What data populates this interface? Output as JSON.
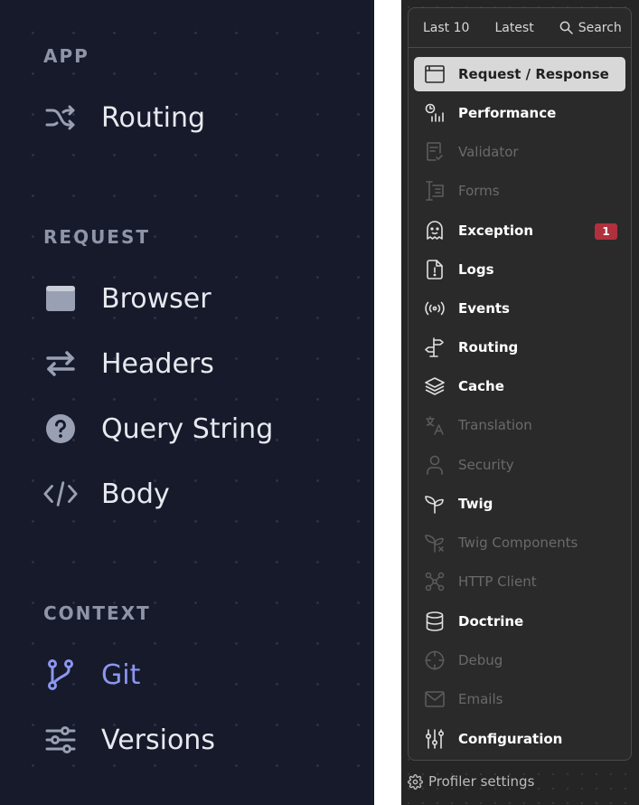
{
  "left_panel": {
    "sections": [
      {
        "title": "APP",
        "items": [
          {
            "label": "Routing",
            "icon": "shuffle-icon"
          }
        ]
      },
      {
        "title": "REQUEST",
        "items": [
          {
            "label": "Browser",
            "icon": "browser-icon"
          },
          {
            "label": "Headers",
            "icon": "arrows-exchange-icon"
          },
          {
            "label": "Query String",
            "icon": "question-circle-icon"
          },
          {
            "label": "Body",
            "icon": "code-icon"
          }
        ]
      },
      {
        "title": "CONTEXT",
        "items": [
          {
            "label": "Git",
            "icon": "git-branch-icon",
            "active": true
          },
          {
            "label": "Versions",
            "icon": "sliders-icon"
          }
        ]
      }
    ],
    "colors": {
      "background": "#161a2b",
      "active": "#8c96f0",
      "text": "#e7e9ef",
      "section": "#8f95a8"
    }
  },
  "profiler_menu": {
    "tabs": {
      "last10": "Last 10",
      "latest": "Latest",
      "search": "Search"
    },
    "items": [
      {
        "label": "Request / Response",
        "icon": "window-icon",
        "selected": true
      },
      {
        "label": "Performance",
        "icon": "timer-bars-icon"
      },
      {
        "label": "Validator",
        "icon": "validator-icon",
        "disabled": true
      },
      {
        "label": "Forms",
        "icon": "form-icon",
        "disabled": true
      },
      {
        "label": "Exception",
        "icon": "ghost-icon",
        "badge": "1"
      },
      {
        "label": "Logs",
        "icon": "log-file-icon"
      },
      {
        "label": "Events",
        "icon": "broadcast-icon"
      },
      {
        "label": "Routing",
        "icon": "signpost-icon"
      },
      {
        "label": "Cache",
        "icon": "layers-icon"
      },
      {
        "label": "Translation",
        "icon": "translate-icon",
        "disabled": true
      },
      {
        "label": "Security",
        "icon": "user-icon",
        "disabled": true
      },
      {
        "label": "Twig",
        "icon": "sprout-icon"
      },
      {
        "label": "Twig Components",
        "icon": "components-icon",
        "disabled": true
      },
      {
        "label": "HTTP Client",
        "icon": "network-icon",
        "disabled": true
      },
      {
        "label": "Doctrine",
        "icon": "database-icon"
      },
      {
        "label": "Debug",
        "icon": "crosshair-icon",
        "disabled": true
      },
      {
        "label": "Emails",
        "icon": "mail-icon",
        "disabled": true
      },
      {
        "label": "Configuration",
        "icon": "adjustments-icon"
      }
    ],
    "settings_label": "Profiler settings",
    "colors": {
      "badge": "#b0313d",
      "selected_bg": "#d8d8d8",
      "dim": "#6a6a6a"
    }
  }
}
